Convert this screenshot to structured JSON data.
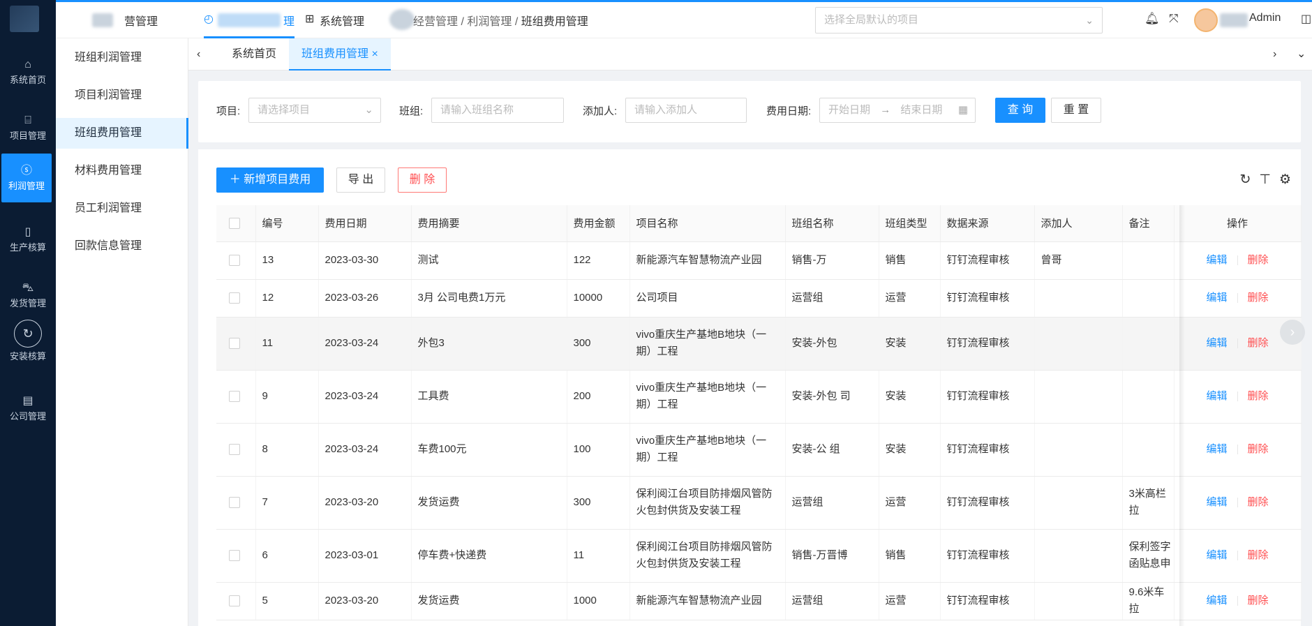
{
  "header": {
    "title": "营管理",
    "nav_system": "系统管理",
    "breadcrumb": [
      "经营管理",
      "利润管理",
      "班组费用管理"
    ],
    "project_placeholder": "选择全局默认的项目",
    "user": "Admin"
  },
  "sidebar": {
    "items": [
      {
        "label": "系统首页",
        "icon": "home-icon"
      },
      {
        "label": "项目管理",
        "icon": "bank-icon"
      },
      {
        "label": "利润管理",
        "icon": "dollar-icon"
      },
      {
        "label": "生产核算",
        "icon": "copy-icon"
      },
      {
        "label": "发货管理",
        "icon": "car-icon"
      },
      {
        "label": "安装核算",
        "icon": "install-icon"
      },
      {
        "label": "公司管理",
        "icon": "building-icon"
      }
    ]
  },
  "subnav": {
    "items": [
      "班组利润管理",
      "项目利润管理",
      "班组费用管理",
      "材料费用管理",
      "员工利润管理",
      "回款信息管理"
    ]
  },
  "tabs": [
    "系统首页",
    "班组费用管理"
  ],
  "filter": {
    "project_label": "项目:",
    "project_placeholder": "请选择项目",
    "team_label": "班组:",
    "team_placeholder": "请输入班组名称",
    "adder_label": "添加人:",
    "adder_placeholder": "请输入添加人",
    "date_label": "费用日期:",
    "date_start": "开始日期",
    "date_end": "结束日期",
    "query": "查 询",
    "reset": "重 置"
  },
  "toolbar": {
    "add": "新增项目费用",
    "export": "导 出",
    "delete": "删 除"
  },
  "table": {
    "columns": [
      "编号",
      "费用日期",
      "费用摘要",
      "费用金额",
      "项目名称",
      "班组名称",
      "班组类型",
      "数据来源",
      "添加人",
      "备注",
      "操作"
    ],
    "edit": "编辑",
    "del": "删除",
    "rows": [
      {
        "id": "13",
        "date": "2023-03-30",
        "summary": "测试",
        "amount": "122",
        "project": "新能源汽车智慧物流产业园",
        "team": "销售-万",
        "type": "销售",
        "source": "钉钉流程审核",
        "adder": "曾哥",
        "note": ""
      },
      {
        "id": "12",
        "date": "2023-03-26",
        "summary": "3月 公司电费1万元",
        "amount": "10000",
        "project": "公司项目",
        "team": "运营组",
        "type": "运营",
        "source": "钉钉流程审核",
        "adder": "",
        "note": ""
      },
      {
        "id": "11",
        "date": "2023-03-24",
        "summary": "外包3",
        "amount": "300",
        "project": "vivo重庆生产基地B地块（一期）工程",
        "team": "安装-外包",
        "type": "安装",
        "source": "钉钉流程审核",
        "adder": "",
        "note": ""
      },
      {
        "id": "9",
        "date": "2023-03-24",
        "summary": "工具费",
        "amount": "200",
        "project": "vivo重庆生产基地B地块（一期）工程",
        "team": "安装-外包 司",
        "type": "安装",
        "source": "钉钉流程审核",
        "adder": "",
        "note": ""
      },
      {
        "id": "8",
        "date": "2023-03-24",
        "summary": "车费100元",
        "amount": "100",
        "project": "vivo重庆生产基地B地块（一期）工程",
        "team": "安装-公 组",
        "type": "安装",
        "source": "钉钉流程审核",
        "adder": "",
        "note": ""
      },
      {
        "id": "7",
        "date": "2023-03-20",
        "summary": "发货运费",
        "amount": "300",
        "project": "保利阅江台项目防排烟风管防火包封供货及安装工程",
        "team": "运营组",
        "type": "运营",
        "source": "钉钉流程审核",
        "adder": "",
        "note": "3米高栏拉"
      },
      {
        "id": "6",
        "date": "2023-03-01",
        "summary": "停车费+快递费",
        "amount": "11",
        "project": "保利阅江台项目防排烟风管防火包封供货及安装工程",
        "team": "销售-万晋博",
        "type": "销售",
        "source": "钉钉流程审核",
        "adder": "",
        "note": "保利签字函贴息申"
      },
      {
        "id": "5",
        "date": "2023-03-20",
        "summary": "发货运费",
        "amount": "1000",
        "project": "新能源汽车智慧物流产业园",
        "team": "运营组",
        "type": "运营",
        "source": "钉钉流程审核",
        "adder": "",
        "note": "9.6米车拉"
      }
    ]
  }
}
